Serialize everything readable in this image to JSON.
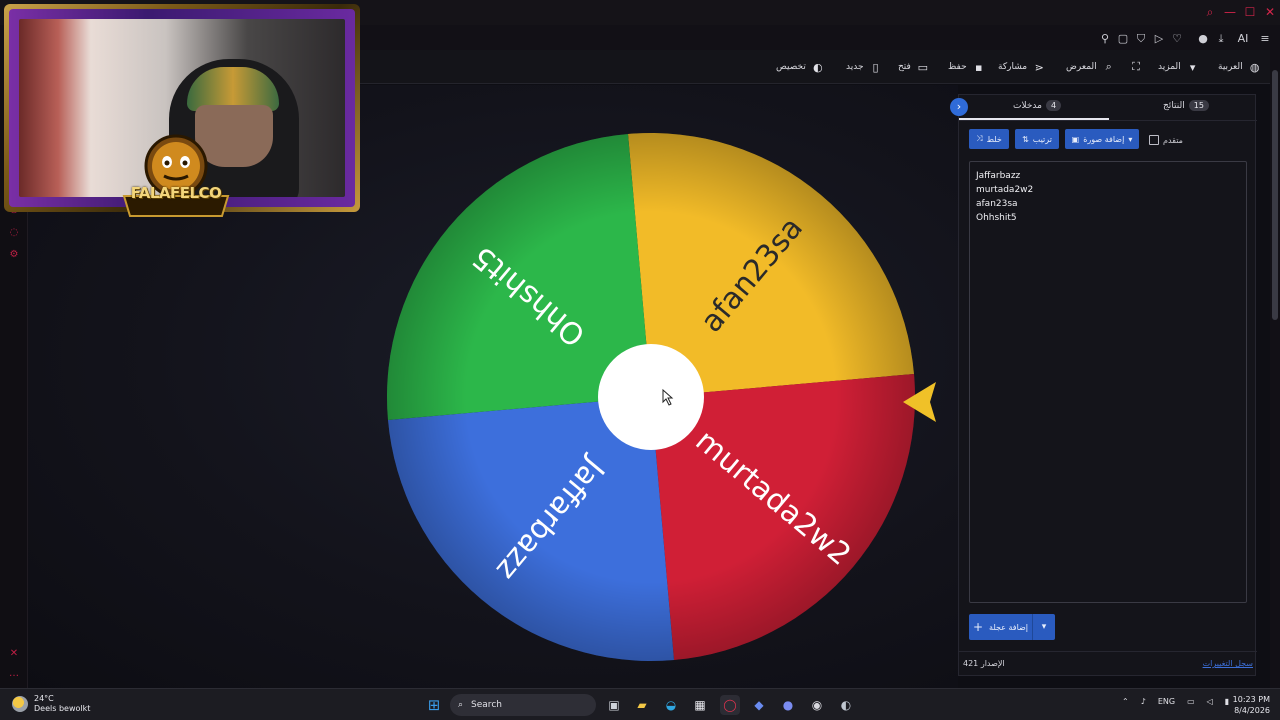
{
  "browser": {
    "toolbar_icons": [
      "pin-icon",
      "tabs-icon",
      "shield-icon",
      "play-icon",
      "heart-icon",
      "profile-icon",
      "download-icon",
      "ai-icon",
      "menu-icon"
    ],
    "ai_label": "AI",
    "accent": "#d3254a"
  },
  "app_bar": {
    "language": "العربية",
    "more": "المزيد",
    "gallery": "المعرض",
    "share": "مشاركة",
    "save": "حفظ",
    "open": "فتح",
    "new": "جديد",
    "customize": "تخصيص"
  },
  "wheel": {
    "center_color": "#ffffff",
    "pointer_color": "#f0c128",
    "segments": [
      {
        "label": "afan23sa",
        "color": "#f2bb28"
      },
      {
        "label": "murtada2w2",
        "color": "#d01f36"
      },
      {
        "label": "Jaffarbazz",
        "color": "#3d6fdc"
      },
      {
        "label": "Ohhshit5",
        "color": "#2cb74a"
      }
    ]
  },
  "webcam": {
    "logo_text": "FALAFELCO"
  },
  "panel": {
    "tab_entries": "مدخلات",
    "tab_entries_count": "4",
    "tab_results": "النتائج",
    "tab_results_count": "15",
    "shuffle": "خلط",
    "sort": "ترتيب",
    "add_image": "إضافة صورة",
    "advanced": "متقدم",
    "entries": [
      "Jaffarbazz",
      "murtada2w2",
      "afan23sa",
      "Ohhshit5"
    ],
    "add_wheel": "إضافة عجلة",
    "version_label": "الإصدار",
    "version_number": "421",
    "changelog": "سجل التغييرات",
    "accent": "#2a5bbf"
  },
  "taskbar": {
    "temperature": "24°C",
    "weather_text": "Deels bewolkt",
    "search_placeholder": "Search",
    "language": "ENG",
    "time": "10:23 PM",
    "date": "8/4/2026"
  }
}
